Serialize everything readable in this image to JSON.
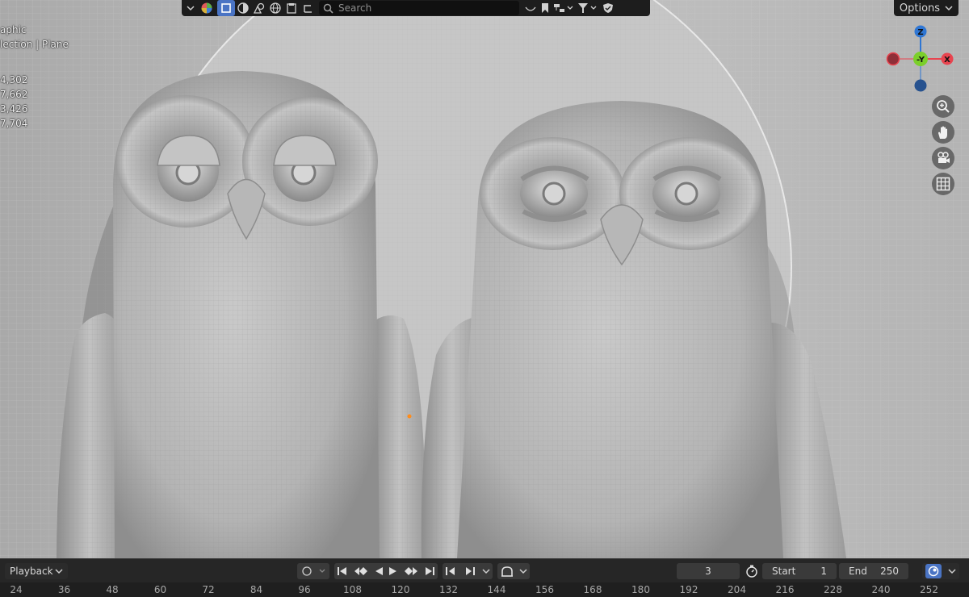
{
  "header": {
    "search_placeholder": "Search"
  },
  "overlay": {
    "line1": "aphic",
    "line2": "lection | Plane",
    "stats": [
      "4,302",
      "7,662",
      "3,426",
      "7,704"
    ]
  },
  "options_label": "Options",
  "gizmo": {
    "z": "Z",
    "neg_y": "-Y",
    "x": "X"
  },
  "timeline": {
    "playback_label": "Playback",
    "current_frame": "3",
    "start_label": "Start",
    "start_value": "1",
    "end_label": "End",
    "end_value": "250"
  },
  "ruler_ticks": [
    "24",
    "36",
    "48",
    "60",
    "72",
    "84",
    "96",
    "108",
    "120",
    "132",
    "144",
    "156",
    "168",
    "180",
    "192",
    "204",
    "216",
    "228",
    "240",
    "252"
  ],
  "colors": {
    "x_axis": "#e8444f",
    "y_axis": "#7bcf2a",
    "z_axis": "#2f76d3",
    "accent": "#4a74c4"
  }
}
